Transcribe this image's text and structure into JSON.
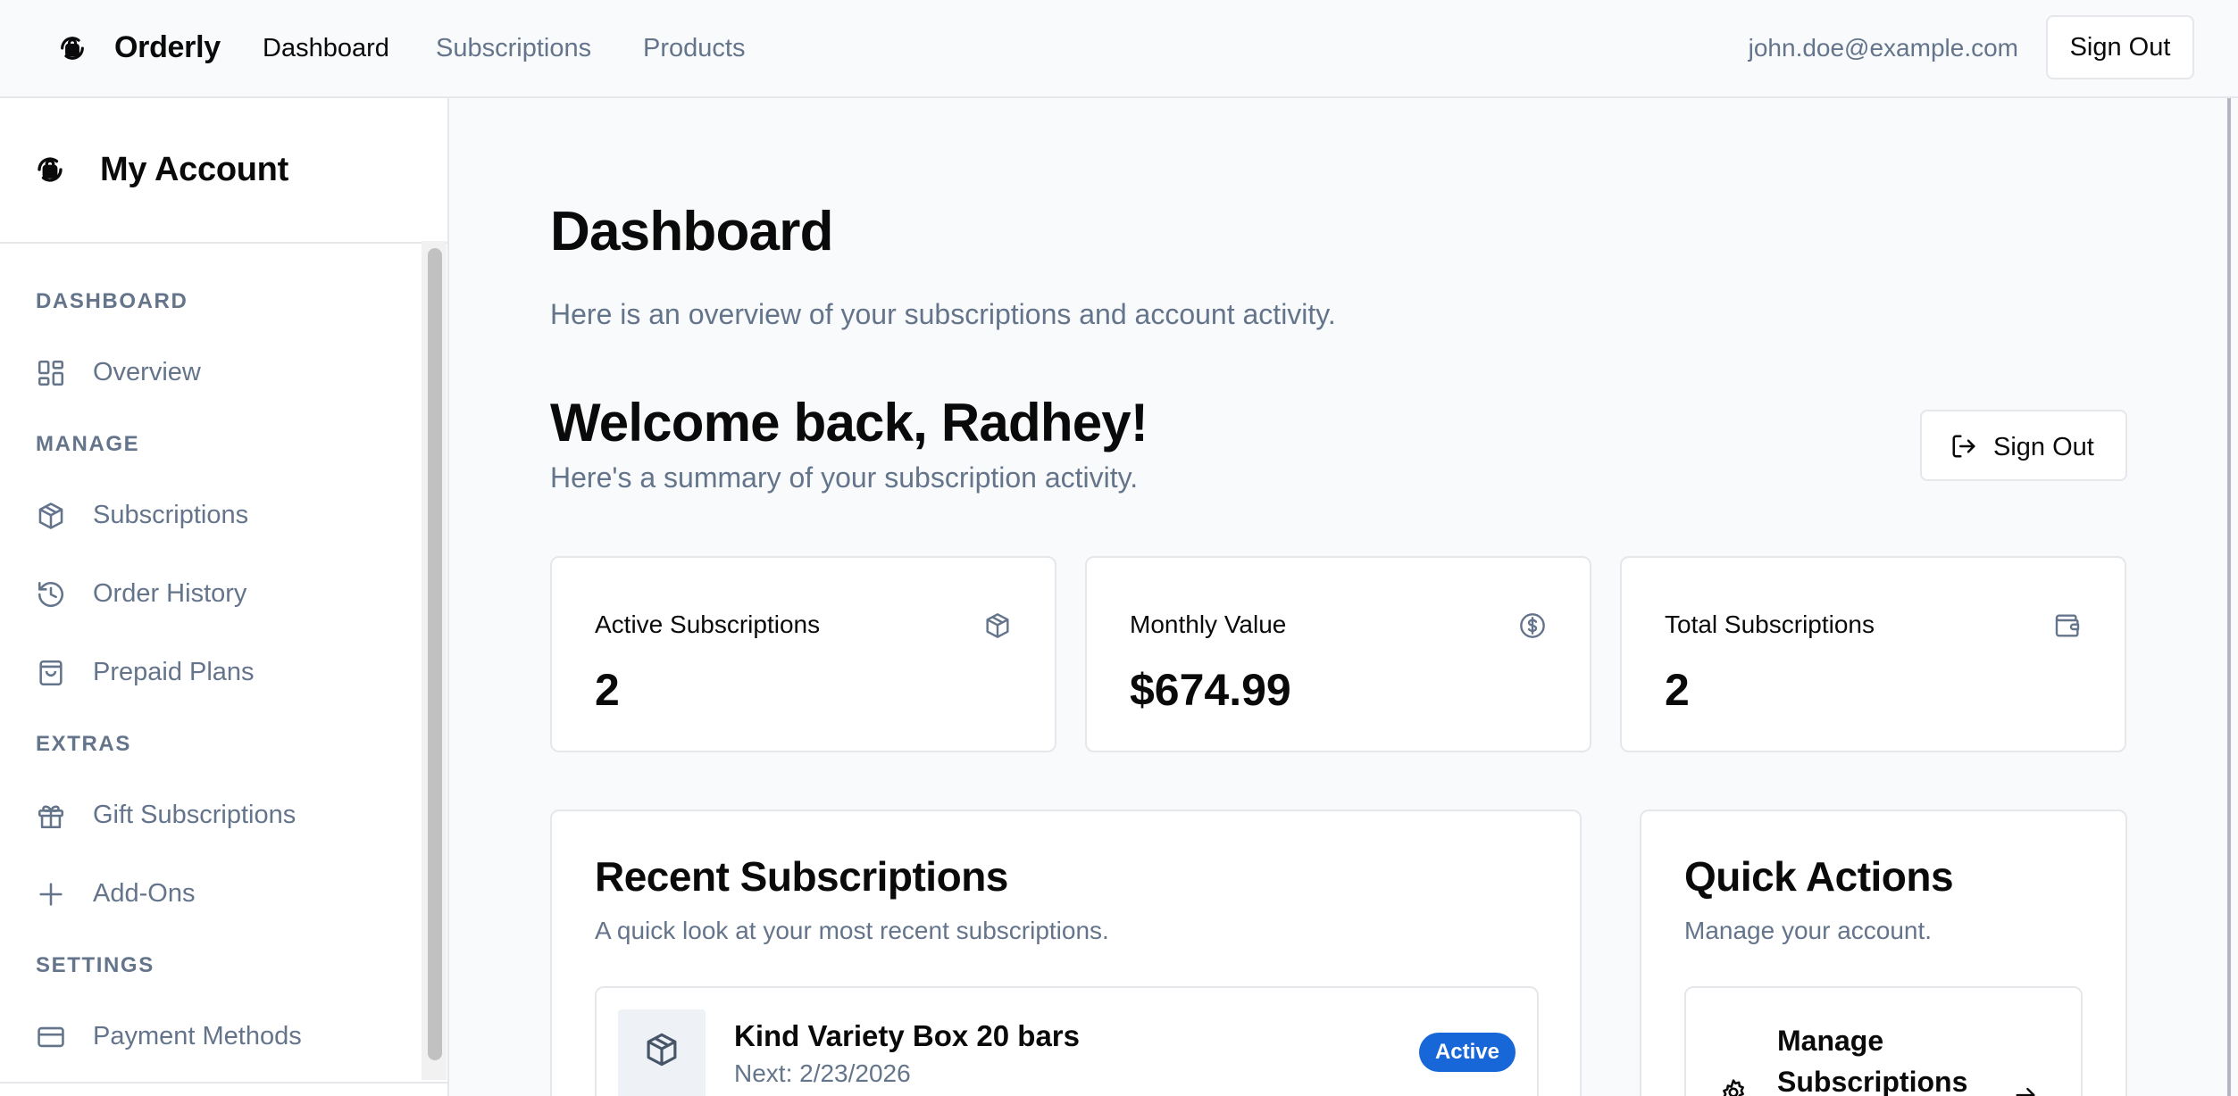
{
  "topnav": {
    "brand": "Orderly",
    "links": [
      "Dashboard",
      "Subscriptions",
      "Products"
    ],
    "user_email": "john.doe@example.com",
    "sign_out": "Sign Out"
  },
  "sidebar": {
    "title": "My Account",
    "sections": [
      {
        "label": "DASHBOARD",
        "items": [
          {
            "label": "Overview",
            "icon": "grid-icon"
          }
        ]
      },
      {
        "label": "MANAGE",
        "items": [
          {
            "label": "Subscriptions",
            "icon": "box-icon"
          },
          {
            "label": "Order History",
            "icon": "history-icon"
          },
          {
            "label": "Prepaid Plans",
            "icon": "shopping-bag-icon"
          }
        ]
      },
      {
        "label": "EXTRAS",
        "items": [
          {
            "label": "Gift Subscriptions",
            "icon": "gift-icon"
          },
          {
            "label": "Add-Ons",
            "icon": "plus-icon"
          }
        ]
      },
      {
        "label": "SETTINGS",
        "items": [
          {
            "label": "Payment Methods",
            "icon": "credit-card-icon"
          }
        ]
      }
    ]
  },
  "main": {
    "title": "Dashboard",
    "subtitle": "Here is an overview of your subscriptions and account activity.",
    "welcome": "Welcome back, Radhey!",
    "welcome_sub": "Here's a summary of your subscription activity.",
    "sign_out": "Sign Out",
    "stats": [
      {
        "title": "Active Subscriptions",
        "value": "2",
        "icon": "box-icon"
      },
      {
        "title": "Monthly Value",
        "value": "$674.99",
        "icon": "dollar-circle-icon"
      },
      {
        "title": "Total Subscriptions",
        "value": "2",
        "icon": "wallet-icon"
      }
    ],
    "recent": {
      "title": "Recent Subscriptions",
      "subtitle": "A quick look at your most recent subscriptions.",
      "items": [
        {
          "name": "Kind Variety Box 20 bars",
          "next": "Next: 2/23/2026",
          "status": "Active"
        }
      ]
    },
    "quick_actions": {
      "title": "Quick Actions",
      "subtitle": "Manage your account.",
      "items": [
        {
          "label": "Manage Subscriptions"
        }
      ]
    }
  },
  "colors": {
    "accent": "#1767d8",
    "muted": "#64748b",
    "border": "#e5e7eb",
    "background": "#f8fafc"
  }
}
